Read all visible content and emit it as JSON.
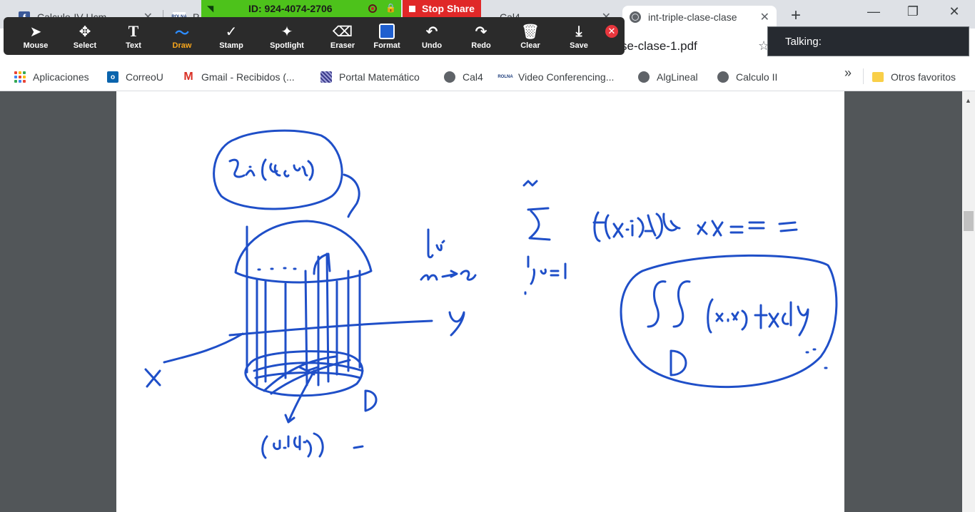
{
  "browser": {
    "tabs": [
      {
        "title": "Calculo-IV Ucm",
        "icon": "facebook-icon"
      },
      {
        "title": "P",
        "icon": "rolna-icon"
      },
      {
        "title": "Cal4",
        "icon": "globe-icon"
      },
      {
        "title": "int-triple-clase-clase",
        "icon": "globe-icon",
        "active": true
      }
    ],
    "new_tab_symbol": "+",
    "close_symbol": "✕",
    "window_controls": {
      "minimize": "—",
      "restore": "❐",
      "close": "✕"
    },
    "url_fragment": "se-clase-1.pdf",
    "star_symbol": "☆"
  },
  "bookmarks": {
    "items": [
      {
        "label": "Aplicaciones",
        "icon": "apps-grid-icon"
      },
      {
        "label": "CorreoU",
        "icon": "outlook-icon"
      },
      {
        "label": "Gmail - Recibidos (...",
        "icon": "gmail-icon"
      },
      {
        "label": "Portal Matemático",
        "icon": "portal-icon"
      },
      {
        "label": "Cal4",
        "icon": "globe-icon"
      },
      {
        "label": "Video Conferencing...",
        "icon": "rolna-icon"
      },
      {
        "label": "AlgLineal",
        "icon": "globe-icon"
      },
      {
        "label": "Calculo II",
        "icon": "globe-icon"
      }
    ],
    "more_symbol": "»",
    "other_favorites": "Otros favoritos"
  },
  "zoom": {
    "meeting_id": "ID: 924-4074-2706",
    "stop_share": "Stop Share",
    "talking_label": "Talking:",
    "tools": [
      {
        "label": "Mouse",
        "icon": "mouse-pointer-icon"
      },
      {
        "label": "Select",
        "icon": "select-move-icon"
      },
      {
        "label": "Text",
        "icon": "text-icon"
      },
      {
        "label": "Draw",
        "icon": "draw-squiggle-icon",
        "active": true
      },
      {
        "label": "Stamp",
        "icon": "stamp-check-icon"
      },
      {
        "label": "Spotlight",
        "icon": "spotlight-wand-icon"
      },
      {
        "label": "Eraser",
        "icon": "eraser-icon"
      },
      {
        "label": "Format",
        "icon": "format-swatch-icon"
      },
      {
        "label": "Undo",
        "icon": "undo-icon"
      },
      {
        "label": "Redo",
        "icon": "redo-icon"
      },
      {
        "label": "Clear",
        "icon": "trash-icon"
      },
      {
        "label": "Save",
        "icon": "save-download-icon"
      }
    ],
    "accent_active": "#f7a61c",
    "format_color": "#1f5fcf"
  },
  "colors": {
    "ink": "#1f4fc8",
    "meeting_green": "#4dc21b",
    "stop_red": "#e02828"
  }
}
